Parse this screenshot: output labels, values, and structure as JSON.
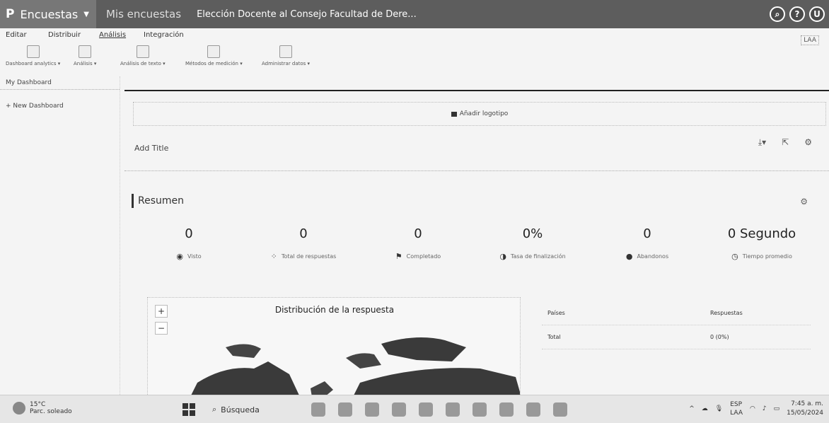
{
  "topbar": {
    "brand_logo": "P",
    "brand_label": "Encuestas",
    "breadcrumb_1": "Mis encuestas",
    "breadcrumb_2": "Elección Docente al Consejo Facultad de Dere...",
    "icons": [
      "search-icon",
      "help-icon",
      "user-avatar"
    ],
    "avatar_letter": "U"
  },
  "menu": {
    "items": [
      "Editar",
      "Distribuir",
      "Análisis",
      "Integración"
    ],
    "active": "Análisis",
    "lang_code": "LAA"
  },
  "toolbar": {
    "items": [
      {
        "label": "Dashboard analytics ▾"
      },
      {
        "label": "Análisis ▾"
      },
      {
        "label": "Análisis de texto ▾"
      },
      {
        "label": "Métodos de medición ▾"
      },
      {
        "label": "Administrar datos ▾"
      }
    ]
  },
  "sidebar": {
    "items": [
      "My Dashboard",
      "+ New Dashboard"
    ]
  },
  "main": {
    "logo_text": "Añadir logotipo",
    "add_title": "Add Title",
    "resumen": "Resumen"
  },
  "stats": [
    {
      "value": "0",
      "label": "Visto",
      "icon": "eye-icon"
    },
    {
      "value": "0",
      "label": "Total de respuestas",
      "icon": "grid-icon"
    },
    {
      "value": "0",
      "label": "Completado",
      "icon": "flag-icon"
    },
    {
      "value": "0%",
      "label": "Tasa de finalización",
      "icon": "percent-circle-icon"
    },
    {
      "value": "0",
      "label": "Abandonos",
      "icon": "abandon-icon"
    },
    {
      "value": "0 Segundo",
      "label": "Tiempo promedio",
      "icon": "clock-icon"
    }
  ],
  "map": {
    "title": "Distribución de la respuesta",
    "zoom_in": "+",
    "zoom_out": "−"
  },
  "response_table": {
    "col_country": "Países",
    "col_responses": "Respuestas",
    "row_country": "Total",
    "row_value": "0 (0%)"
  },
  "taskbar": {
    "weather_temp": "15°C",
    "weather_desc": "Parc. soleado",
    "search_placeholder": "Búsqueda",
    "lang_1": "ESP",
    "lang_2": "LAA",
    "time": "7:45 a. m.",
    "date": "15/05/2024"
  }
}
